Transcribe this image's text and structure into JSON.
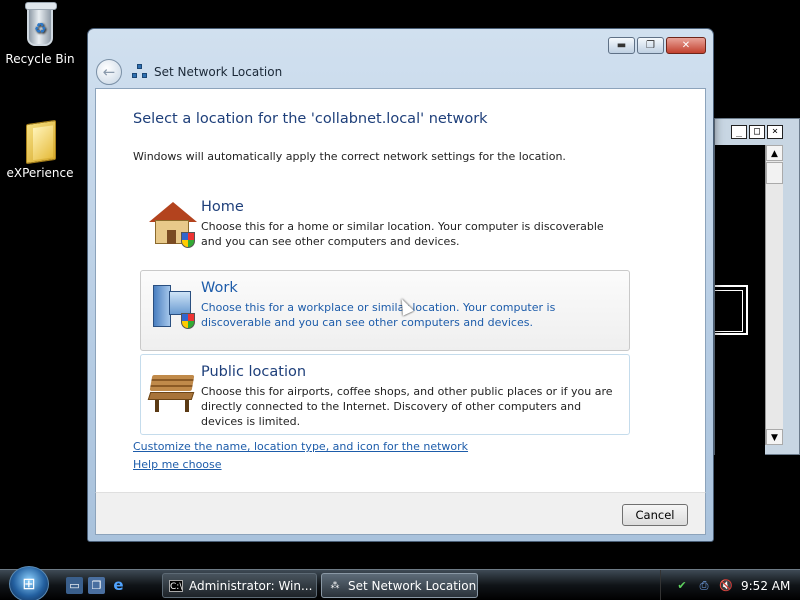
{
  "desktop": {
    "icons": [
      {
        "label": "Recycle Bin"
      },
      {
        "label": "eXPerience"
      }
    ]
  },
  "dialog": {
    "title": "Set Network Location",
    "heading": "Select a location for the 'collabnet.local' network",
    "intro": "Windows will automatically apply the correct network settings for the location.",
    "options": [
      {
        "label": "Home",
        "description": "Choose this for a home or similar location. Your computer is discoverable and you can see other computers and devices."
      },
      {
        "label": "Work",
        "description": "Choose this for a workplace or similar location. Your computer is discoverable and you can see other computers and devices."
      },
      {
        "label": "Public location",
        "description": "Choose this for airports, coffee shops, and other public places or if you are directly connected to the Internet. Discovery of other computers and devices is limited."
      }
    ],
    "links": {
      "customize": "Customize the name, location type, and icon for the network",
      "help": "Help me choose"
    },
    "cancel_label": "Cancel"
  },
  "taskbar": {
    "tasks": [
      {
        "label": "Administrator:  Win..."
      },
      {
        "label": "Set Network Location"
      }
    ],
    "clock": "9:52 AM"
  },
  "colors": {
    "heading": "#1e3f7a",
    "link": "#1d5caa"
  }
}
